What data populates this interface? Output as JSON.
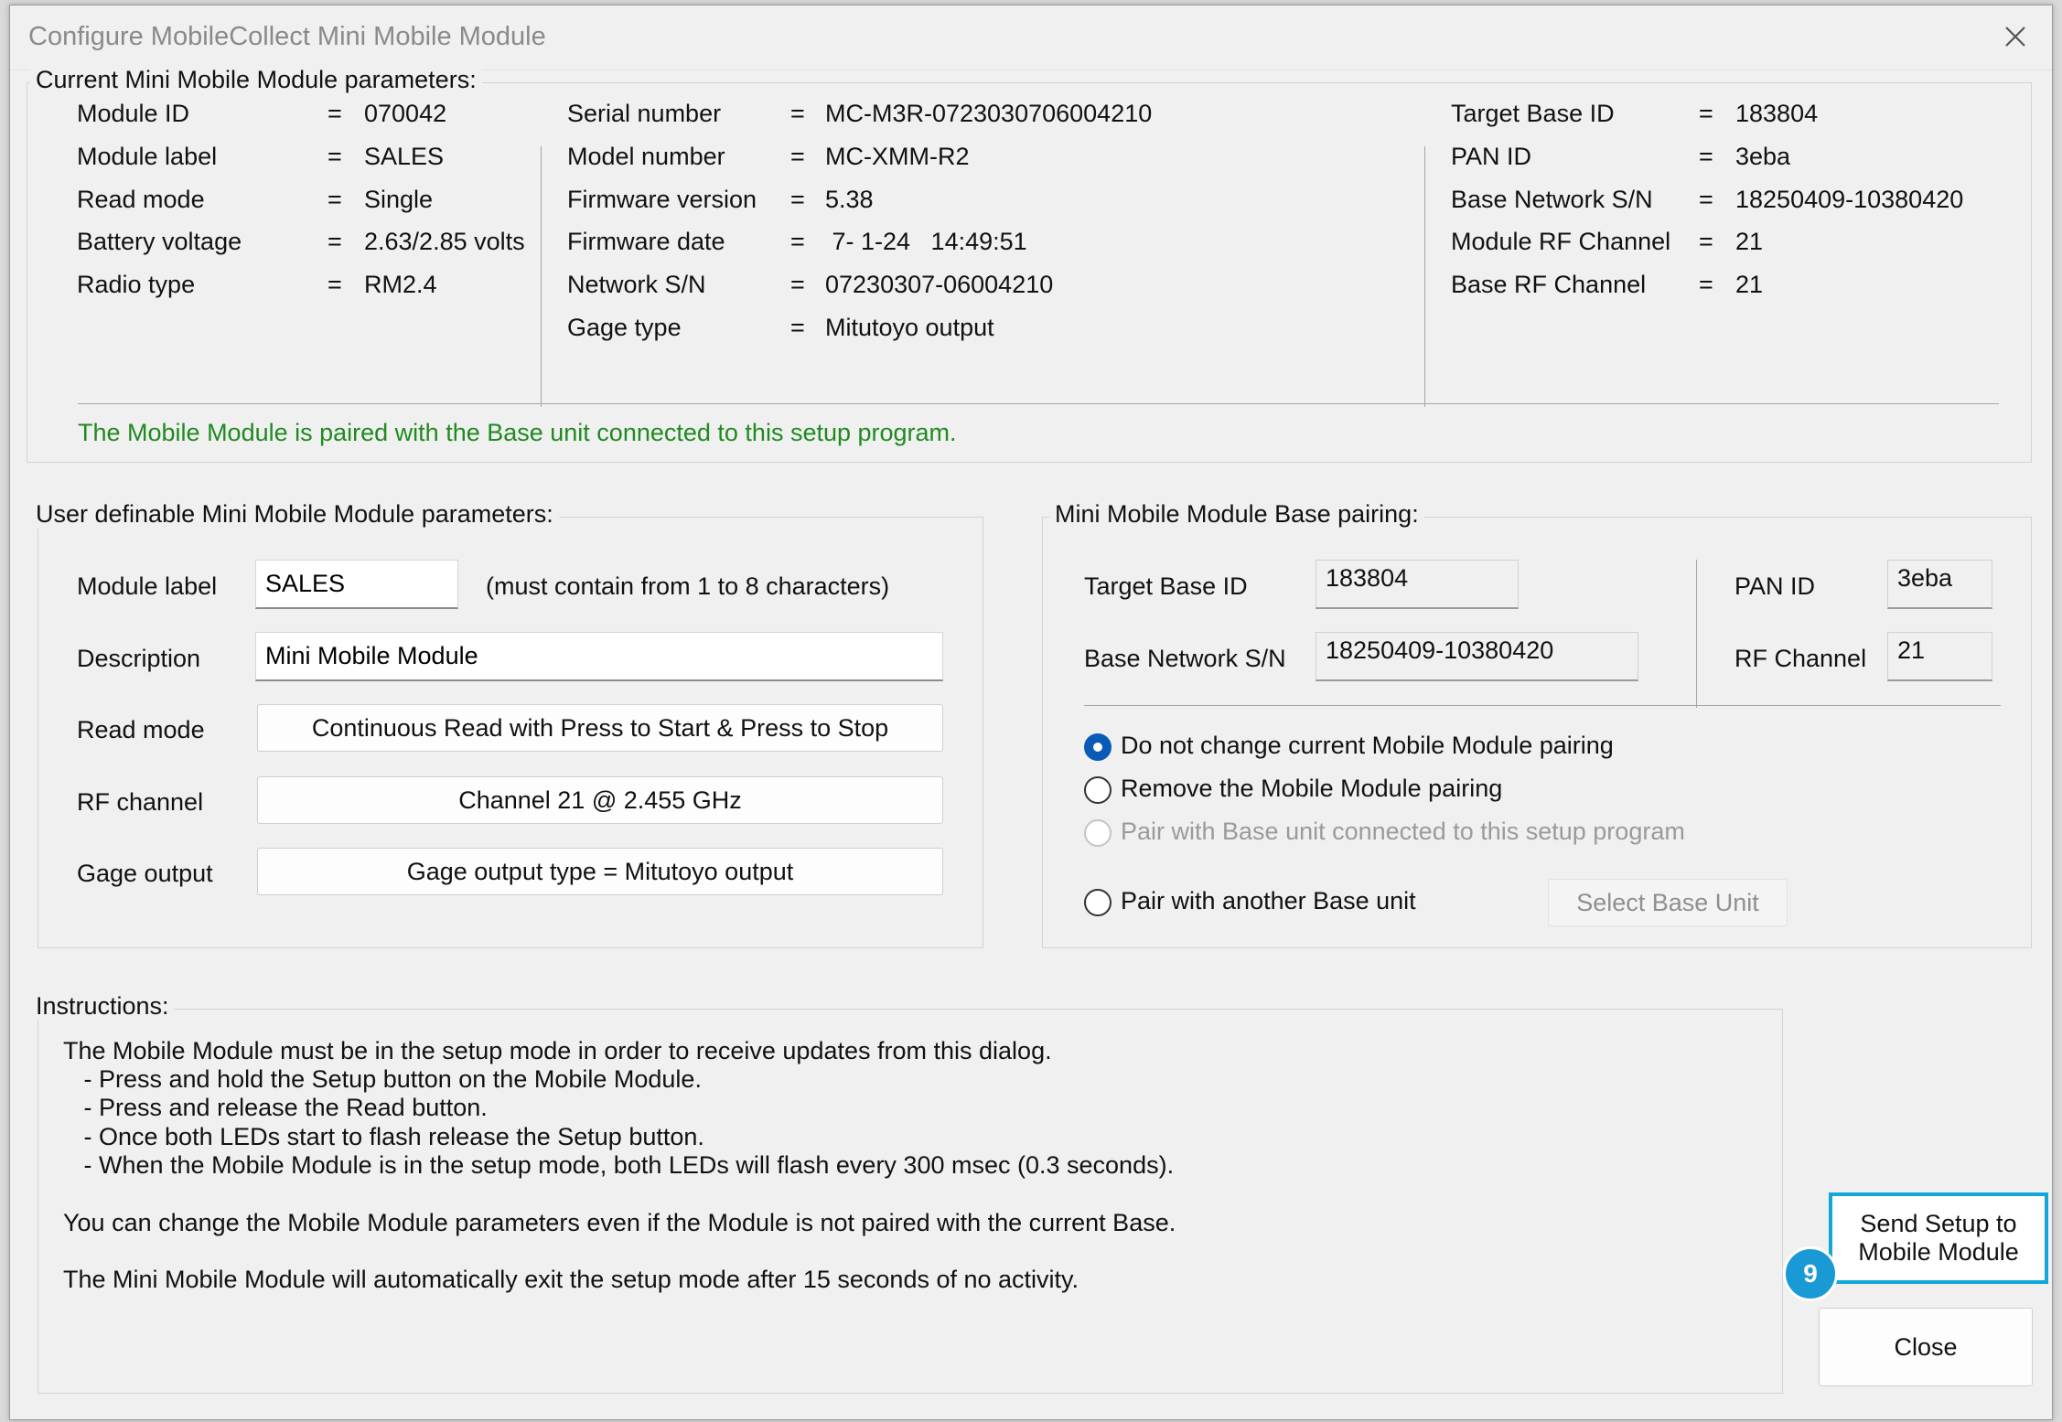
{
  "window": {
    "title": "Configure MobileCollect Mini Mobile Module",
    "close_icon": "close-icon"
  },
  "current": {
    "group_title": "Current Mini Mobile Module parameters:",
    "col1": [
      {
        "label": "Module ID",
        "eq": "=",
        "value": "070042"
      },
      {
        "label": "Module label",
        "eq": "=",
        "value": "SALES"
      },
      {
        "label": "Read mode",
        "eq": "=",
        "value": "Single"
      },
      {
        "label": "Battery voltage",
        "eq": "=",
        "value": "2.63/2.85 volts"
      },
      {
        "label": "Radio type",
        "eq": "=",
        "value": "RM2.4"
      }
    ],
    "col2": [
      {
        "label": "Serial number",
        "eq": "=",
        "value": "MC-M3R-0723030706004210"
      },
      {
        "label": "Model number",
        "eq": "=",
        "value": "MC-XMM-R2"
      },
      {
        "label": "Firmware version",
        "eq": "=",
        "value": "5.38"
      },
      {
        "label": "Firmware date",
        "eq": "=",
        "value": " 7- 1-24   14:49:51"
      },
      {
        "label": "Network S/N",
        "eq": "=",
        "value": "07230307-06004210"
      },
      {
        "label": "Gage type",
        "eq": "=",
        "value": "Mitutoyo output"
      }
    ],
    "col3": [
      {
        "label": "Target Base ID",
        "eq": "=",
        "value": "183804"
      },
      {
        "label": "PAN ID",
        "eq": "=",
        "value": "3eba"
      },
      {
        "label": "Base Network S/N",
        "eq": "=",
        "value": "18250409-10380420"
      },
      {
        "label": "Module RF Channel",
        "eq": "=",
        "value": "21"
      },
      {
        "label": "Base RF Channel",
        "eq": "=",
        "value": "21"
      }
    ],
    "status": "The Mobile Module is paired with the Base unit connected to this setup program.",
    "status_color": "#1f8a1f"
  },
  "user": {
    "group_title": "User definable Mini Mobile Module parameters:",
    "module_label_label": "Module label",
    "module_label_value": "SALES",
    "module_label_hint": "(must contain from 1 to 8 characters)",
    "description_label": "Description",
    "description_value": "Mini Mobile Module",
    "read_mode_label": "Read mode",
    "read_mode_button": "Continuous Read with Press to Start & Press to Stop",
    "rf_channel_label": "RF channel",
    "rf_channel_button": "Channel 21 @ 2.455 GHz",
    "gage_output_label": "Gage output",
    "gage_output_button": "Gage output type = Mitutoyo output"
  },
  "pairing": {
    "group_title": "Mini Mobile Module Base pairing:",
    "target_base_id_label": "Target Base ID",
    "target_base_id_value": "183804",
    "base_network_sn_label": "Base Network S/N",
    "base_network_sn_value": "18250409-10380420",
    "pan_id_label": "PAN ID",
    "pan_id_value": "3eba",
    "rf_channel_label": "RF Channel",
    "rf_channel_value": "21",
    "options": [
      {
        "label": "Do not change current Mobile Module pairing",
        "checked": true,
        "enabled": true
      },
      {
        "label": "Remove the Mobile Module pairing",
        "checked": false,
        "enabled": true
      },
      {
        "label": "Pair with Base unit connected to this setup program",
        "checked": false,
        "enabled": false
      },
      {
        "label": "Pair with another Base unit",
        "checked": false,
        "enabled": true
      }
    ],
    "select_base_button": "Select Base Unit",
    "accent_color": "#0a5ab8"
  },
  "instructions": {
    "group_title": "Instructions:",
    "lines": [
      "The Mobile Module must be in the setup mode in order to receive updates from this dialog.",
      "   - Press and hold the Setup button on the Mobile Module.",
      "   - Press and release the Read button.",
      "   - Once both LEDs start to flash release the Setup button.",
      "   - When the Mobile Module is in the setup mode, both LEDs will flash every 300 msec (0.3 seconds).",
      "You can change the Mobile Module parameters even if the Module is not paired with the current Base.",
      "The Mini Mobile Module will automatically exit the setup mode after 15 seconds of no activity."
    ]
  },
  "actions": {
    "send_line1": "Send Setup to",
    "send_line2": "Mobile Module",
    "step_badge": "9",
    "highlight_color": "#11a7d8",
    "close_button": "Close"
  }
}
